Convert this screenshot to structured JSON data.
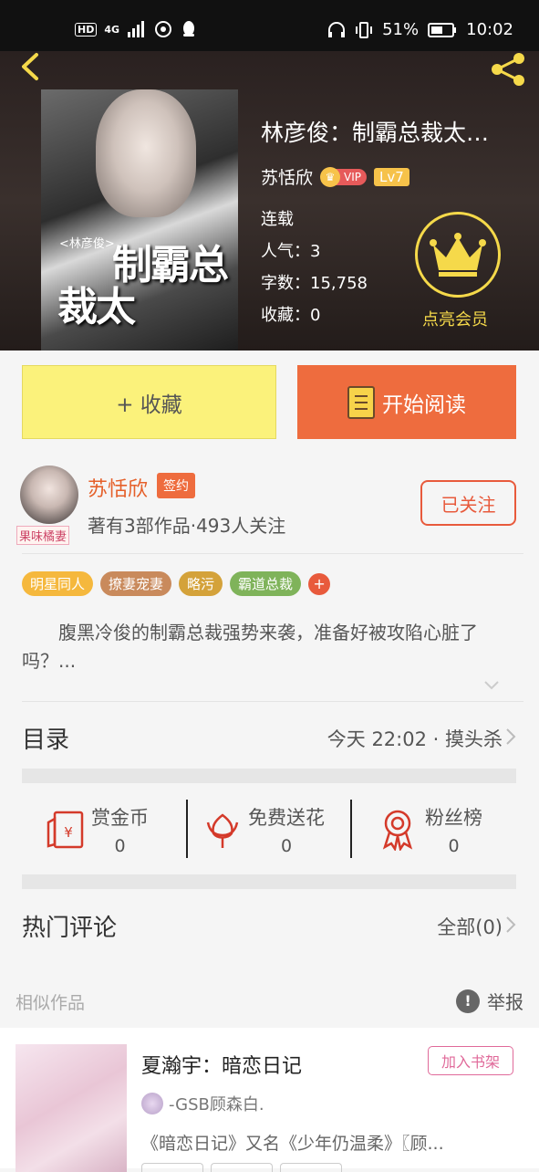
{
  "status_bar": {
    "hd": "HD",
    "network": "4G",
    "battery": "51%",
    "time": "10:02"
  },
  "book": {
    "title": "林彦俊：制霸总裁太…",
    "author": "苏恬欣",
    "vip_badge": "VIP",
    "level": "Lv7",
    "status": "连载",
    "popularity": "人气：3",
    "word_count": "字数：15,758",
    "favorites": "收藏：0",
    "vip_cta": "点亮会员",
    "cover_title_line1": "制霸总",
    "cover_title_line2": "裁太",
    "cover_subtitle": "<林彦俊>"
  },
  "actions": {
    "favorite_label": "+ 收藏",
    "read_label": "开始阅读"
  },
  "author_card": {
    "name": "苏恬欣",
    "signed_badge": "签约",
    "avatar_tag": "果味橘妻",
    "info": "著有3部作品·493人关注",
    "follow_label": "已关注"
  },
  "tags": [
    {
      "label": "明星同人",
      "color": "#f5b83d"
    },
    {
      "label": "撩妻宠妻",
      "color": "#c98a5c"
    },
    {
      "label": "略污",
      "color": "#d4a23a"
    },
    {
      "label": "霸道总裁",
      "color": "#7fb35a"
    }
  ],
  "tag_add": "+",
  "summary": "腹黑冷俊的制霸总裁强势来袭，准备好被攻陷心脏了吗？...",
  "catalog": {
    "title": "目录",
    "latest": "今天 22:02 · 摸头杀"
  },
  "rewards": [
    {
      "label": "赏金币",
      "value": "0",
      "icon": "red-envelope-icon"
    },
    {
      "label": "免费送花",
      "value": "0",
      "icon": "flower-icon"
    },
    {
      "label": "粉丝榜",
      "value": "0",
      "icon": "medal-icon"
    }
  ],
  "comments": {
    "title": "热门评论",
    "all_label": "全部(0)"
  },
  "similar": {
    "header": "相似作品",
    "report_label": "举报",
    "item": {
      "title": "夏瀚宇：暗恋日记",
      "add_label": "加入书架",
      "author": "-GSB顾森白.",
      "desc": "《暗恋日记》又名《少年仍温柔》〖顾..."
    }
  }
}
